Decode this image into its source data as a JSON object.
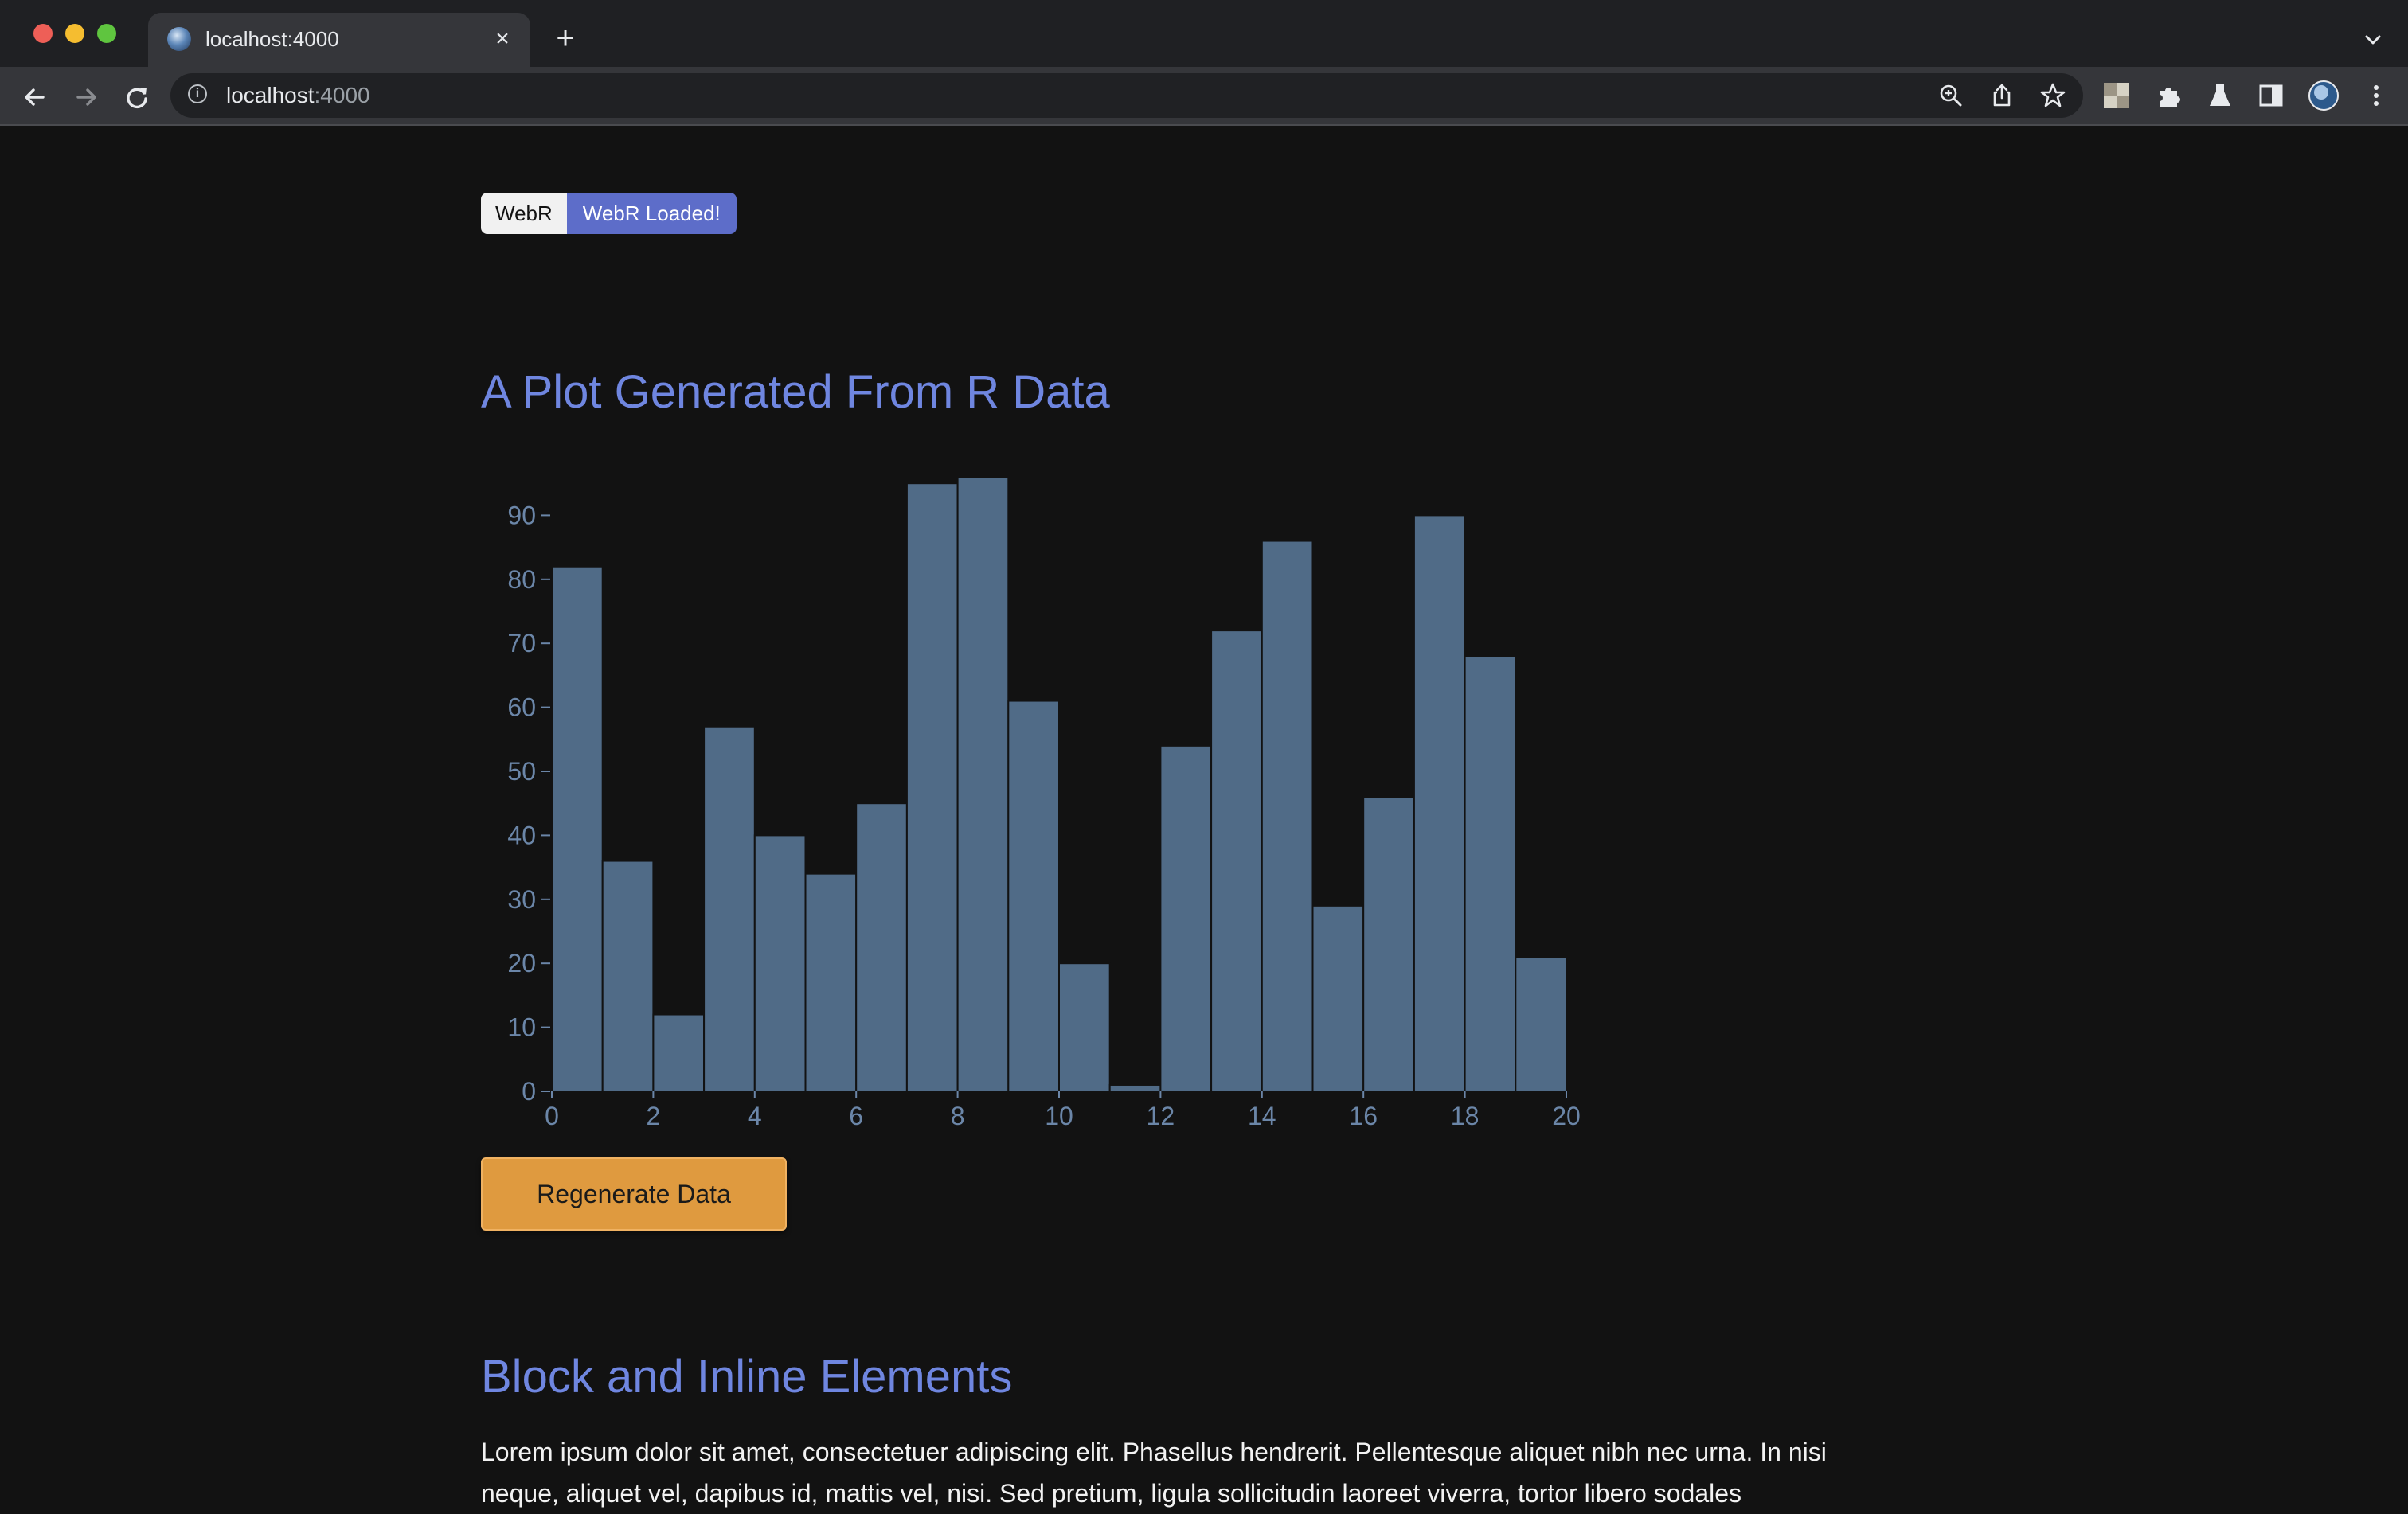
{
  "browser": {
    "tab_title": "localhost:4000",
    "url_host": "localhost",
    "url_port": ":4000",
    "close_glyph": "×",
    "newtab_glyph": "+",
    "icons": [
      "back-icon",
      "forward-icon",
      "reload-icon",
      "info-icon",
      "zoom-icon",
      "share-icon",
      "bookmark-star-icon",
      "chess-extension-icon",
      "puzzle-extensions-icon",
      "flask-labs-icon",
      "side-panel-icon",
      "profile-avatar-icon",
      "more-menu-icon",
      "tab-list-chevron-icon"
    ]
  },
  "page": {
    "badge_label": "WebR",
    "badge_status": "WebR Loaded!",
    "plot_title": "A Plot Generated From R Data",
    "button_label": "Regenerate Data",
    "section_title": "Block and Inline Elements",
    "paragraph": "Lorem ipsum dolor sit amet, consectetuer adipiscing elit. Phasellus hendrerit. Pellentesque aliquet nibh nec urna. In nisi neque, aliquet vel, dapibus id, mattis vel, nisi. Sed pretium, ligula sollicitudin laoreet viverra, tortor libero sodales"
  },
  "colors": {
    "background": "#121212",
    "heading": "#6f86e0",
    "badge_status_bg": "#5d6dc9",
    "bar_fill": "#506b87",
    "axis": "#6b86a8",
    "button_bg": "#df9a3f"
  },
  "chart_data": {
    "type": "bar",
    "title": "",
    "xlabel": "",
    "ylabel": "",
    "x_bin_edges": [
      0,
      1,
      2,
      3,
      4,
      5,
      6,
      7,
      8,
      9,
      10,
      11,
      12,
      13,
      14,
      15,
      16,
      17,
      18,
      19,
      20
    ],
    "values": [
      82,
      36,
      12,
      57,
      40,
      34,
      45,
      95,
      96,
      61,
      20,
      1,
      54,
      72,
      86,
      29,
      46,
      90,
      68,
      21
    ],
    "xlim": [
      0,
      20
    ],
    "ylim": [
      0,
      96
    ],
    "x_ticks": [
      0,
      2,
      4,
      6,
      8,
      10,
      12,
      14,
      16,
      18,
      20
    ],
    "y_ticks": [
      0,
      10,
      20,
      30,
      40,
      50,
      60,
      70,
      80,
      90
    ],
    "grid": false
  }
}
